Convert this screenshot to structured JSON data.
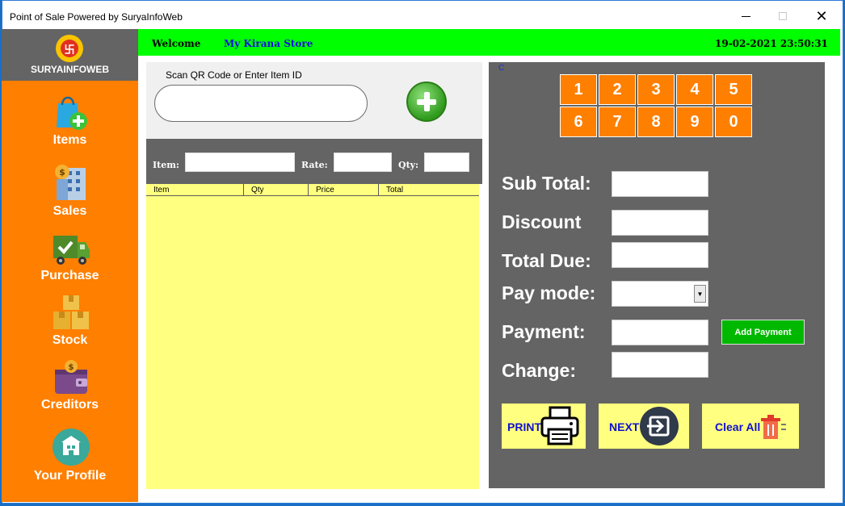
{
  "window": {
    "title": "Point of Sale Powered by SuryaInfoWeb"
  },
  "sidebar": {
    "brand": "SURYAINFOWEB",
    "items": [
      {
        "label": "Items",
        "icon": "shopping-bag-plus-icon"
      },
      {
        "label": "Sales",
        "icon": "sales-building-icon"
      },
      {
        "label": "Purchase",
        "icon": "delivery-truck-icon"
      },
      {
        "label": "Stock",
        "icon": "boxes-icon"
      },
      {
        "label": "Creditors",
        "icon": "wallet-icon"
      },
      {
        "label": "Your Profile",
        "icon": "store-profile-icon"
      }
    ]
  },
  "header": {
    "welcome": "Welcome",
    "store_name": "My Kirana Store",
    "datetime": "19-02-2021 23:50:31"
  },
  "scan": {
    "label": "Scan QR Code or Enter Item ID",
    "value": ""
  },
  "entry": {
    "item_label": "Item:",
    "rate_label": "Rate:",
    "qty_label": "Qty:"
  },
  "cart": {
    "columns": [
      "Item",
      "Qty",
      "Price",
      "Total"
    ],
    "rows": []
  },
  "checkout": {
    "marker": "C",
    "keypad": [
      "1",
      "2",
      "3",
      "4",
      "5",
      "6",
      "7",
      "8",
      "9",
      "0"
    ],
    "sub_total_label": "Sub Total:",
    "discount_label": "Discount",
    "total_due_label": "Total Due:",
    "pay_mode_label": "Pay mode:",
    "payment_label": "Payment:",
    "change_label": "Change:",
    "add_payment_label": "Add Payment",
    "print_label": "PRINT",
    "next_label": "NEXT",
    "clear_label": "Clear All"
  },
  "colors": {
    "sidebar": "#ff7f00",
    "topbar": "#00ff00",
    "panel": "#646464",
    "cart_bg": "#ffff80",
    "accent_text": "#1010d0"
  }
}
